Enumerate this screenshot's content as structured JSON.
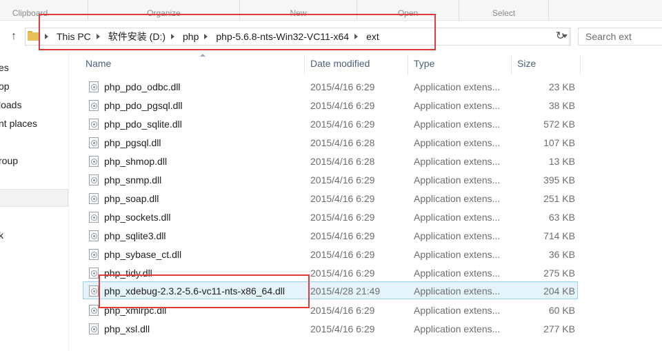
{
  "ribbon": {
    "groups": [
      "Clipboard",
      "Organize",
      "New",
      "Open",
      "Select"
    ]
  },
  "address": {
    "path": [
      "This PC",
      "软件安装 (D:)",
      "php",
      "php-5.6.8-nts-Win32-VC11-x64",
      "ext"
    ],
    "search_placeholder": "Search ext"
  },
  "nav": {
    "items": [
      "es",
      "op",
      "loads",
      "nt places",
      "roup",
      "k"
    ]
  },
  "columns": {
    "name": "Name",
    "date": "Date modified",
    "type": "Type",
    "size": "Size"
  },
  "files": [
    {
      "name": "php_pdo_odbc.dll",
      "date": "2015/4/16 6:29",
      "type": "Application extens...",
      "size": "23 KB"
    },
    {
      "name": "php_pdo_pgsql.dll",
      "date": "2015/4/16 6:29",
      "type": "Application extens...",
      "size": "38 KB"
    },
    {
      "name": "php_pdo_sqlite.dll",
      "date": "2015/4/16 6:29",
      "type": "Application extens...",
      "size": "572 KB"
    },
    {
      "name": "php_pgsql.dll",
      "date": "2015/4/16 6:28",
      "type": "Application extens...",
      "size": "107 KB"
    },
    {
      "name": "php_shmop.dll",
      "date": "2015/4/16 6:28",
      "type": "Application extens...",
      "size": "13 KB"
    },
    {
      "name": "php_snmp.dll",
      "date": "2015/4/16 6:29",
      "type": "Application extens...",
      "size": "395 KB"
    },
    {
      "name": "php_soap.dll",
      "date": "2015/4/16 6:29",
      "type": "Application extens...",
      "size": "251 KB"
    },
    {
      "name": "php_sockets.dll",
      "date": "2015/4/16 6:29",
      "type": "Application extens...",
      "size": "63 KB"
    },
    {
      "name": "php_sqlite3.dll",
      "date": "2015/4/16 6:29",
      "type": "Application extens...",
      "size": "714 KB"
    },
    {
      "name": "php_sybase_ct.dll",
      "date": "2015/4/16 6:29",
      "type": "Application extens...",
      "size": "36 KB"
    },
    {
      "name": "php_tidy.dll",
      "date": "2015/4/16 6:29",
      "type": "Application extens...",
      "size": "275 KB"
    },
    {
      "name": "php_xdebug-2.3.2-5.6-vc11-nts-x86_64.dll",
      "date": "2015/4/28 21:49",
      "type": "Application extens...",
      "size": "204 KB"
    },
    {
      "name": "php_xmlrpc.dll",
      "date": "2015/4/16 6:29",
      "type": "Application extens...",
      "size": "60 KB"
    },
    {
      "name": "php_xsl.dll",
      "date": "2015/4/16 6:29",
      "type": "Application extens...",
      "size": "277 KB"
    }
  ],
  "colors": {
    "highlight": "#e03b3b",
    "selection": "#e5f3fb",
    "selection_border": "#99d1f0"
  }
}
